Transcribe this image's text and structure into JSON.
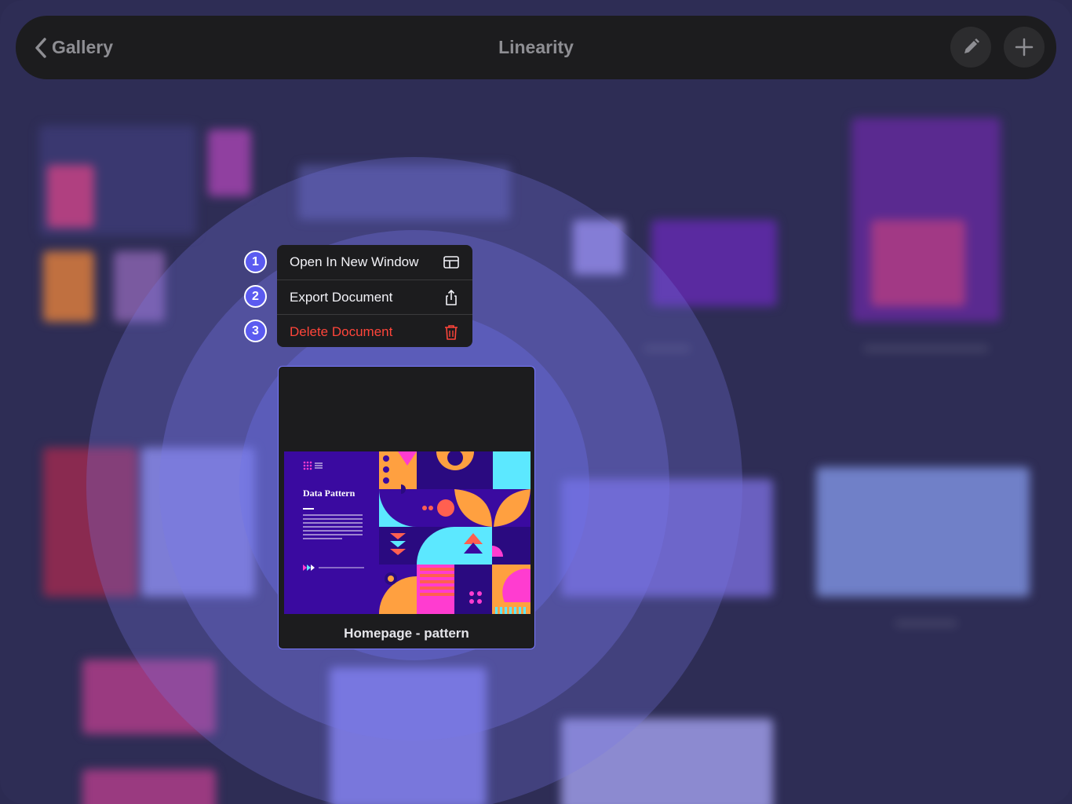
{
  "topbar": {
    "back_label": "Gallery",
    "title": "Linearity"
  },
  "context_menu": {
    "items": [
      {
        "badge": "1",
        "label": "Open In New Window",
        "icon": "window-layout-icon"
      },
      {
        "badge": "2",
        "label": "Export Document",
        "icon": "share-icon"
      },
      {
        "badge": "3",
        "label": "Delete Document",
        "icon": "trash-icon"
      }
    ]
  },
  "preview": {
    "caption": "Homepage - pattern",
    "artwork_title": "Data Pattern"
  },
  "colors": {
    "accent": "#5b5bf0",
    "danger": "#ff453a",
    "bar": "#1c1c1e",
    "background": "#2e2d55"
  }
}
